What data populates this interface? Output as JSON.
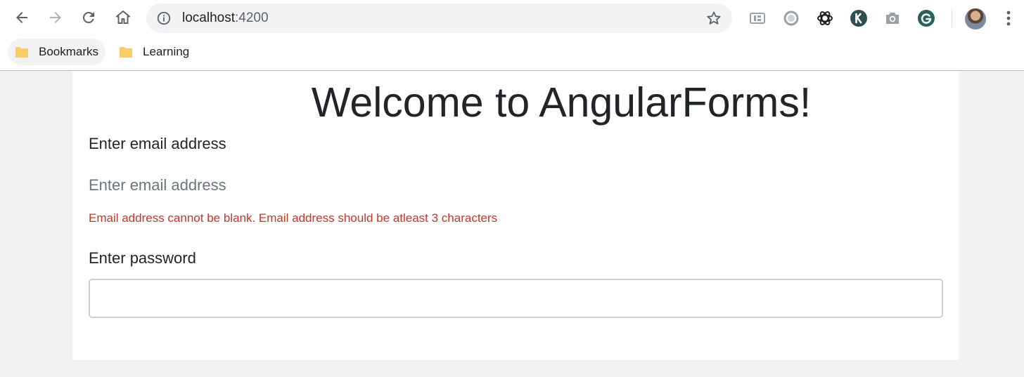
{
  "browser": {
    "url_host": "localhost",
    "url_port": ":4200",
    "bookmarks": [
      {
        "label": "Bookmarks"
      },
      {
        "label": "Learning"
      }
    ],
    "icons": {
      "back": "back-arrow-icon",
      "forward": "forward-arrow-icon",
      "reload": "reload-icon",
      "home": "home-icon",
      "site_info": "info-icon",
      "bookmark_star": "star-icon",
      "extensions": [
        "reader-mode-icon",
        "circle-extension-icon",
        "openai-extension-icon",
        "k-extension-icon",
        "camera-icon",
        "grammarly-icon"
      ],
      "menu": "more-vert-icon"
    },
    "colors": {
      "folder": "#f6ce64",
      "omnibox_bg": "#f1f3f4"
    }
  },
  "page": {
    "title": "Welcome to AngularForms!",
    "email": {
      "label": "Enter email address",
      "placeholder": "Enter email address",
      "value": "",
      "error": "Email address cannot be blank. Email address should be atleast 3 characters"
    },
    "password": {
      "label": "Enter password",
      "value": ""
    },
    "colors": {
      "background": "#f2f2f2",
      "card": "#ffffff",
      "text": "#212529",
      "error": "#c0392b",
      "input_border": "#c7d0d9"
    }
  }
}
